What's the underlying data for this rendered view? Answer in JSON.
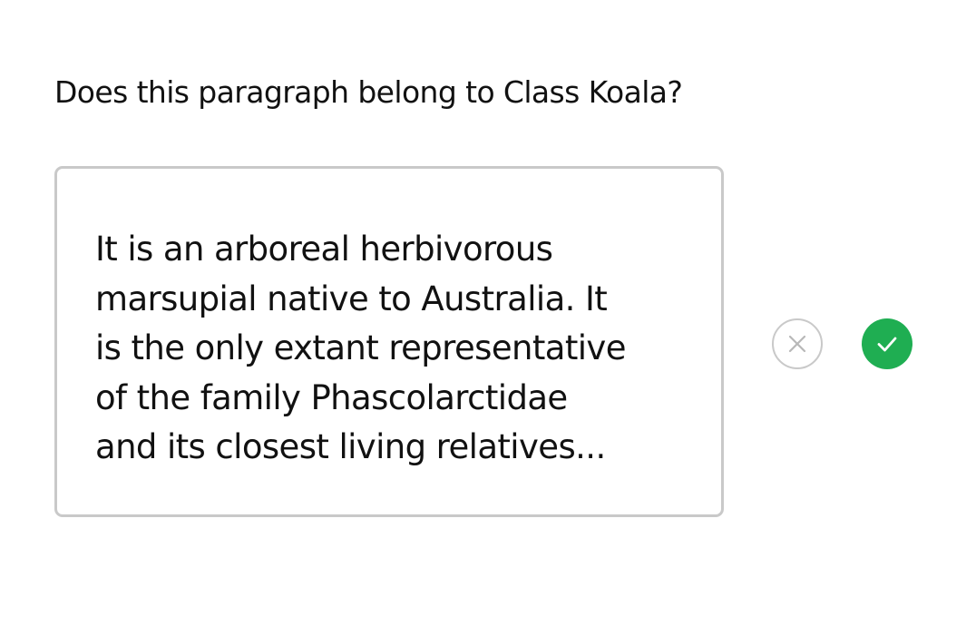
{
  "prompt": {
    "question": "Does this paragraph belong to Class Koala?"
  },
  "card": {
    "paragraph": "It is an arboreal herbivorous\nmarsupial native to Australia. It\nis the only extant representative\nof the family Phascolarctidae\nand its closest living relatives..."
  },
  "actions": {
    "reject_icon": "close-icon",
    "accept_icon": "check-icon",
    "accept_color": "#1fae52",
    "reject_border_color": "#c9c9c9"
  }
}
